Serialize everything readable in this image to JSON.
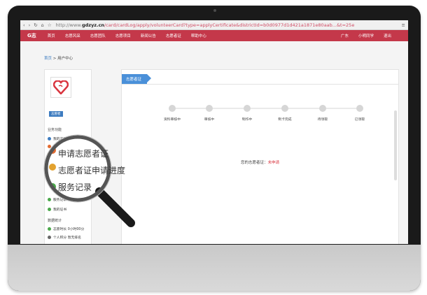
{
  "browser": {
    "url_prefix": "http://www.",
    "url_domain": "gdzyz.cn",
    "url_path": "/card/cardLog/apply/volunteerCard?type=applyCertificate&districtId=b0d0977d1d421a1871e80aab...&t=25e"
  },
  "topnav": {
    "logo": "G志",
    "items": [
      "首页",
      "志愿风采",
      "志愿团队",
      "志愿项目",
      "新闻公告",
      "志愿者证",
      "帮助中心"
    ],
    "right_items": [
      "广东",
      "小明同学",
      "退出"
    ]
  },
  "breadcrumb": {
    "home": "首页",
    "separator": " > ",
    "current": "用户中心"
  },
  "sidebar": {
    "badge": "志愿者",
    "section1_title": "业务功能",
    "items": [
      "我的志愿服务",
      "申请志愿者证",
      "志愿者证申请进度",
      "服务记录",
      "我的证书"
    ],
    "section2_title": "数据统计",
    "stats": [
      "志愿时长 0小时00分",
      "个人积分 暂无排名"
    ]
  },
  "panel": {
    "tab": "志愿者证",
    "steps": [
      "资料审核中",
      "审核中",
      "制作中",
      "制卡完成",
      "待领取",
      "已领取"
    ],
    "status_label": "您的志愿者证：",
    "status_value": "未申请"
  },
  "magnifier": {
    "lines": [
      "申请志愿者证",
      "志愿者证申请进度",
      "服务记录"
    ]
  },
  "colors": {
    "brand": "#c4384a",
    "accent": "#4a90d9"
  }
}
